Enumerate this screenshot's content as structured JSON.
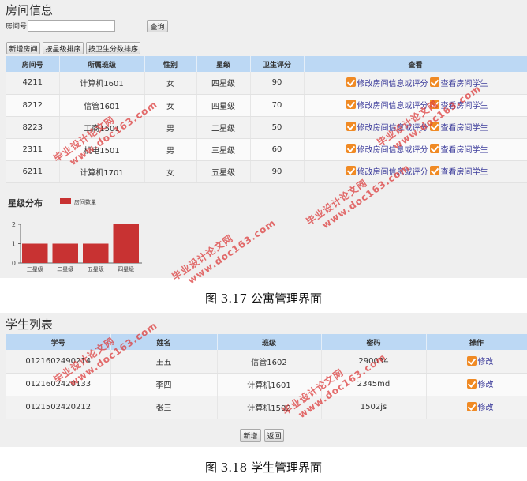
{
  "apartment": {
    "title": "房间信息",
    "room_label": "房间号:",
    "room_value": "",
    "query_label": "查询",
    "toolbar": [
      "新增房间",
      "按星级排序",
      "按卫生分数排序"
    ],
    "columns": [
      "房间号",
      "所属班级",
      "性别",
      "星级",
      "卫生评分",
      "查看"
    ],
    "rows": [
      [
        "4211",
        "计算机1601",
        "女",
        "四星级",
        "90"
      ],
      [
        "8212",
        "信管1601",
        "女",
        "四星级",
        "70"
      ],
      [
        "8223",
        "工商1501",
        "男",
        "二星级",
        "50"
      ],
      [
        "2311",
        "机电1501",
        "男",
        "三星级",
        "60"
      ],
      [
        "6211",
        "计算机1701",
        "女",
        "五星级",
        "90"
      ]
    ],
    "action_edit": "修改房间信息或评分",
    "action_view": "查看房间学生",
    "chart_title": "星级分布"
  },
  "chart_data": {
    "type": "bar",
    "categories": [
      "三星级",
      "二星级",
      "五星级",
      "四星级"
    ],
    "series": [
      {
        "name": "房间数量",
        "values": [
          1,
          1,
          1,
          2
        ]
      }
    ],
    "ylim": [
      0,
      2
    ],
    "yticks": [
      "0",
      "1",
      "2"
    ],
    "legend": "top",
    "bar_color": "#c83232",
    "grid": false
  },
  "caption1": "图 3.17 公寓管理界面",
  "students": {
    "title": "学生列表",
    "columns": [
      "学号",
      "姓名",
      "班级",
      "密码",
      "操作"
    ],
    "rows": [
      [
        "0121602490214",
        "王五",
        "信管1602",
        "290034"
      ],
      [
        "0121602420133",
        "李四",
        "计算机1601",
        "2345md"
      ],
      [
        "0121502420212",
        "张三",
        "计算机1502",
        "1502js"
      ]
    ],
    "action_edit": "修改",
    "add_label": "新增",
    "back_label": "返回"
  },
  "caption2": "图 3.18 学生管理界面",
  "watermark": {
    "line1": "毕业设计论文网",
    "line2": "www.doc163.com"
  },
  "colors": {
    "header": "#bcd8f4",
    "accent": "#f08a24",
    "link": "#3a3a9a",
    "watermark": "#dc3c3c"
  }
}
